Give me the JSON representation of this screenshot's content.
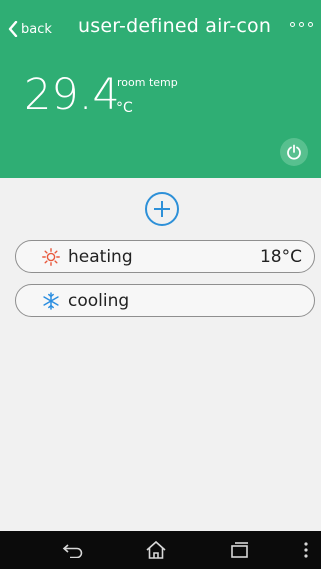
{
  "header": {
    "back_label": "back",
    "title": "user-defined air-con",
    "room_temp_value": "29.4",
    "room_temp_unit": "°C",
    "room_temp_label": "room temp"
  },
  "modes": [
    {
      "name": "heating",
      "value": "18°C",
      "icon": "sun-icon"
    },
    {
      "name": "cooling",
      "value": "",
      "icon": "snowflake-icon"
    }
  ],
  "colors": {
    "header_bg": "#2fae74",
    "accent_blue": "#2d90d8",
    "heating_icon": "#e8583c",
    "cooling_icon": "#2b8ee0"
  },
  "navbar": {
    "buttons": [
      "back-icon",
      "home-icon",
      "recent-apps-icon",
      "menu-icon"
    ]
  }
}
